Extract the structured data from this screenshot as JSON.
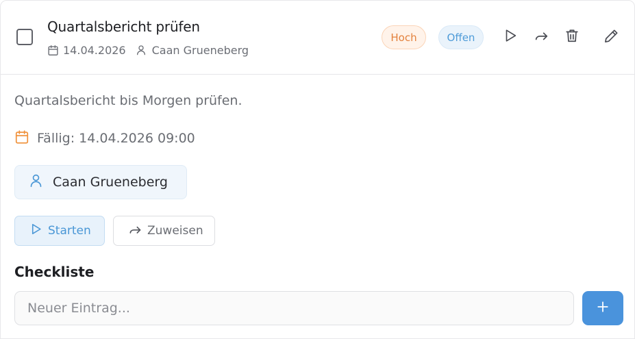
{
  "task": {
    "title": "Quartalsbericht prüfen",
    "date": "14.04.2026",
    "assignee": "Caan Grueneberg",
    "priority": "Hoch",
    "status": "Offen",
    "checked": false
  },
  "details": {
    "description": "Quartalsbericht bis Morgen prüfen.",
    "due_label": "Fällig: 14.04.2026 09:00",
    "assignee": "Caan Grueneberg"
  },
  "actions": {
    "start_label": "Starten",
    "assign_label": "Zuweisen"
  },
  "checklist": {
    "title": "Checkliste",
    "placeholder": "Neuer Eintrag...",
    "add_label": "+"
  },
  "icons": {
    "header": [
      "play-icon",
      "forward-icon",
      "trash-icon",
      "edit-icon"
    ],
    "meta": [
      "calendar-icon",
      "user-icon"
    ]
  },
  "colors": {
    "priority_high_text": "#e3813d",
    "priority_high_bg": "#fff3ea",
    "status_open_text": "#4e9bd8",
    "status_open_bg": "#eaf3fb",
    "accent": "#4a93dc",
    "due_icon": "#f0933e"
  }
}
